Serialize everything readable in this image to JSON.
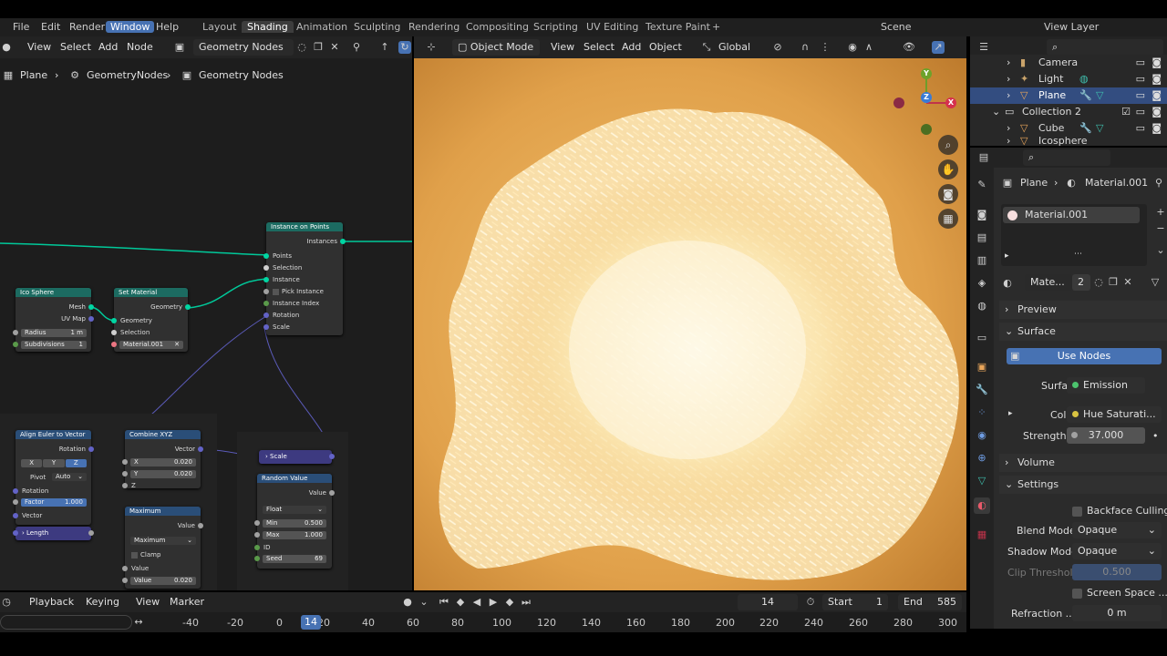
{
  "topbar": {
    "menus": [
      "File",
      "Edit",
      "Render",
      "Window",
      "Help"
    ],
    "workspaces": [
      "Layout",
      "Shading",
      "Animation",
      "Sculpting",
      "Rendering",
      "Compositing",
      "Scripting",
      "UV Editing",
      "Texture Paint"
    ],
    "active_workspace": "Shading",
    "add_tab": "+",
    "scene": "Scene",
    "view_layer": "View Layer"
  },
  "node_editor": {
    "menus": [
      "View",
      "Select",
      "Add",
      "Node"
    ],
    "tree_name": "Geometry Nodes",
    "breadcrumb": [
      "Plane",
      "GeometryNodes",
      "Geometry Nodes"
    ],
    "nodes": {
      "instance_on_points": {
        "title": "Instance on Points",
        "out": "Instances",
        "inputs": [
          "Points",
          "Selection",
          "Instance",
          "Pick Instance",
          "Instance Index",
          "Rotation",
          "Scale"
        ]
      },
      "ico_sphere": {
        "title": "Ico Sphere",
        "outs": [
          "Mesh",
          "UV Map"
        ],
        "radius_label": "Radius",
        "radius": "1 m",
        "subdiv_label": "Subdivisions",
        "subdiv": "1"
      },
      "set_material": {
        "title": "Set Material",
        "out": "Geometry",
        "inputs": [
          "Geometry",
          "Selection"
        ],
        "material": "Material.001"
      },
      "align_euler": {
        "title": "Align Euler to Vector",
        "out": "Rotation",
        "axes": [
          "X",
          "Y",
          "Z"
        ],
        "pivot_label": "Pivot",
        "pivot": "Auto",
        "rotation_label": "Rotation",
        "factor_label": "Factor",
        "factor": "1.000",
        "vector_label": "Vector"
      },
      "combine_xyz": {
        "title": "Combine XYZ",
        "out": "Vector",
        "x_label": "X",
        "x": "0.020",
        "y_label": "Y",
        "y": "0.020",
        "z_label": "Z"
      },
      "scale_reroute": {
        "title": "Scale"
      },
      "length": {
        "title": "Length"
      },
      "random_value": {
        "title": "Random Value",
        "out": "Value",
        "type": "Float",
        "min_label": "Min",
        "min": "0.500",
        "max_label": "Max",
        "max": "1.000",
        "id_label": "ID",
        "seed_label": "Seed",
        "seed": "69"
      },
      "maximum": {
        "title": "Maximum",
        "out": "Value",
        "op": "Maximum",
        "clamp": "Clamp",
        "value_label": "Value",
        "value_label2": "Value",
        "value": "0.020"
      }
    }
  },
  "viewport": {
    "mode": "Object Mode",
    "menus": [
      "View",
      "Select",
      "Add",
      "Object"
    ],
    "transform": "Global",
    "gizmo": {
      "x": "X",
      "y": "Y",
      "z": "Z"
    }
  },
  "outliner": {
    "rows": [
      {
        "label": "Camera",
        "selected": false
      },
      {
        "label": "Light",
        "selected": false
      },
      {
        "label": "Plane",
        "selected": true
      },
      {
        "label": "Collection 2",
        "selected": false
      },
      {
        "label": "Cube",
        "selected": false
      },
      {
        "label": "Icosphere",
        "selected": false
      }
    ]
  },
  "properties": {
    "breadcrumb_object": "Plane",
    "breadcrumb_material": "Material.001",
    "slot": "Material.001",
    "mat_name": "Mate...",
    "mat_users": "2",
    "panels": {
      "preview": "Preview",
      "surface": "Surface",
      "volume": "Volume",
      "settings": "Settings"
    },
    "use_nodes": "Use Nodes",
    "surface_label": "Surface",
    "surface_value": "Emission",
    "color_label": "Color",
    "color_value": "Hue Saturati...",
    "strength_label": "Strength",
    "strength_value": "37.000",
    "backface": "Backface Culling",
    "blend_label": "Blend Mode",
    "blend_value": "Opaque",
    "shadow_label": "Shadow Mode",
    "shadow_value": "Opaque",
    "clip_label": "Clip Threshold",
    "clip_value": "0.500",
    "screen_space": "Screen Space ...",
    "refraction_label": "Refraction ...",
    "refraction_value": "0 m"
  },
  "timeline": {
    "menus": [
      "Playback",
      "Keying",
      "View",
      "Marker"
    ],
    "current_frame": "14",
    "start_label": "Start",
    "start": "1",
    "end_label": "End",
    "end": "585",
    "ticks": [
      "-40",
      "-20",
      "0",
      "20",
      "40",
      "60",
      "80",
      "100",
      "120",
      "140",
      "160",
      "180",
      "200",
      "220",
      "240",
      "260",
      "280",
      "300"
    ],
    "playhead": "14"
  },
  "colors": {
    "accent": "#4772b3",
    "geo_header": "#1c6b61",
    "vec_header": "#2a4e78",
    "emission_bg": "#e6a64a"
  }
}
